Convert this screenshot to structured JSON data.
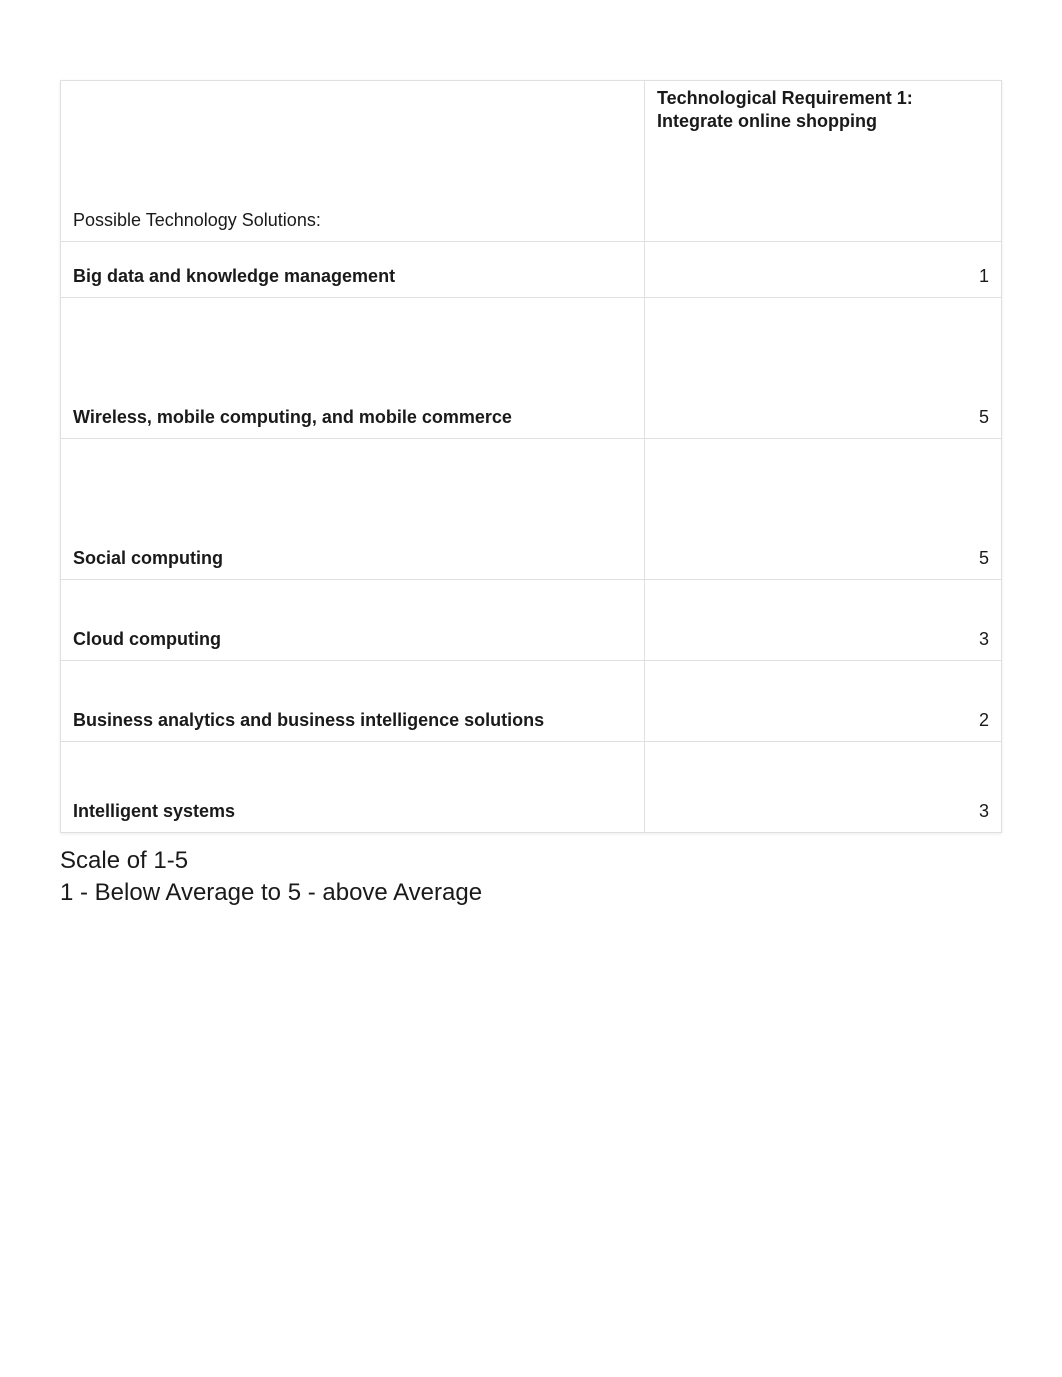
{
  "chart_data": {
    "type": "table",
    "header": {
      "left": "Possible Technology Solutions:",
      "right_line1": "Technological Requirement 1:",
      "right_line2": "Integrate online shopping"
    },
    "rows": [
      {
        "label": "Big data and knowledge management",
        "value": 1
      },
      {
        "label": "Wireless, mobile computing, and mobile commerce",
        "value": 5
      },
      {
        "label": "Social computing",
        "value": 5
      },
      {
        "label": "Cloud computing",
        "value": 3
      },
      {
        "label": "Business analytics and business intelligence solutions",
        "value": 2
      },
      {
        "label": "Intelligent systems",
        "value": 3
      }
    ]
  },
  "footer": {
    "line1": "Scale of 1-5",
    "line2": " 1 - Below Average to 5 - above Average"
  }
}
